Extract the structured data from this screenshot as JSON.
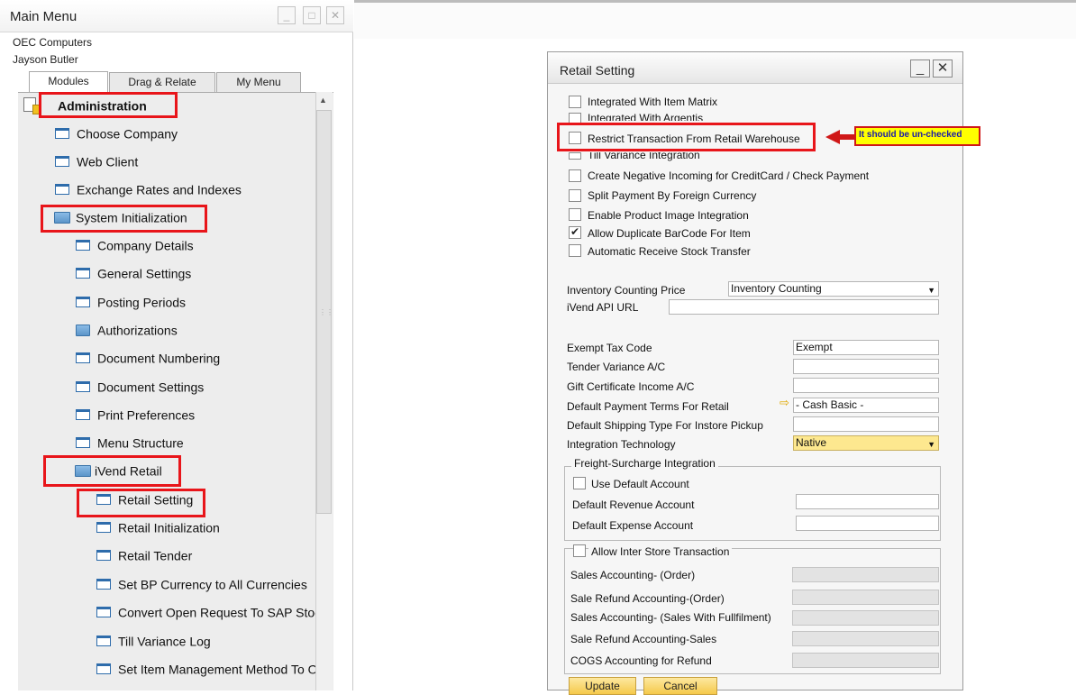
{
  "main_menu": {
    "title": "Main Menu",
    "company": "OEC Computers",
    "user": "Jayson Butler",
    "tabs": [
      "Modules",
      "Drag & Relate",
      "My Menu"
    ],
    "items": [
      {
        "label": "Administration"
      },
      {
        "label": "Choose Company"
      },
      {
        "label": "Web Client"
      },
      {
        "label": "Exchange Rates and Indexes"
      },
      {
        "label": "System Initialization"
      },
      {
        "label": "Company Details"
      },
      {
        "label": "General Settings"
      },
      {
        "label": "Posting Periods"
      },
      {
        "label": "Authorizations"
      },
      {
        "label": "Document Numbering"
      },
      {
        "label": "Document Settings"
      },
      {
        "label": "Print Preferences"
      },
      {
        "label": "Menu Structure"
      },
      {
        "label": "iVend Retail"
      },
      {
        "label": "Retail Setting"
      },
      {
        "label": "Retail Initialization"
      },
      {
        "label": "Retail Tender"
      },
      {
        "label": "Set BP Currency to All Currencies"
      },
      {
        "label": "Convert Open Request To SAP Stock Transfer"
      },
      {
        "label": "Till Variance Log"
      },
      {
        "label": "Set Item Management Method To On Every Transaction"
      }
    ]
  },
  "dialog": {
    "title": "Retail Setting",
    "checkboxes": [
      {
        "label": "Integrated With Item Matrix",
        "checked": false
      },
      {
        "label": "Integrated With Argentis",
        "checked": false
      },
      {
        "label": "Restrict Transaction From Retail Warehouse",
        "checked": false
      },
      {
        "label": "Till Variance Integration",
        "checked": false
      },
      {
        "label": "Create Negative Incoming for CreditCard / Check Payment",
        "checked": false
      },
      {
        "label": "Split Payment By Foreign Currency",
        "checked": false
      },
      {
        "label": "Enable Product Image Integration",
        "checked": false
      },
      {
        "label": "Allow Duplicate BarCode For Item",
        "checked": true
      },
      {
        "label": "Automatic Receive Stock Transfer",
        "checked": false
      }
    ],
    "inventory_counting_price": {
      "label": "Inventory Counting Price",
      "value": "Inventory Counting"
    },
    "ivend_api_url": {
      "label": "iVend API URL",
      "value": ""
    },
    "fields": [
      {
        "label": "Exempt Tax Code",
        "value": "Exempt"
      },
      {
        "label": "Tender Variance A/C",
        "value": ""
      },
      {
        "label": "Gift Certificate Income A/C",
        "value": ""
      },
      {
        "label": "Default Payment Terms For Retail",
        "value": "- Cash Basic -"
      },
      {
        "label": "Default Shipping Type For Instore Pickup",
        "value": ""
      },
      {
        "label": "Integration Technology",
        "value": "Native"
      }
    ],
    "freight_group": {
      "title": "Freight-Surcharge Integration",
      "use_default": "Use Default Account",
      "revenue": "Default Revenue Account",
      "expense": "Default Expense Account"
    },
    "inter_store": {
      "label": "Allow Inter Store Transaction",
      "fields": [
        "Sales Accounting- (Order)",
        "Sale Refund Accounting-(Order)",
        "Sales Accounting- (Sales With Fullfilment)",
        "Sale Refund Accounting-Sales",
        "COGS Accounting for Refund"
      ]
    },
    "buttons": {
      "update": "Update",
      "cancel": "Cancel"
    }
  },
  "callout": "It should be un-checked",
  "colors": {
    "highlight": "#e8151a",
    "callout_bg": "#ffff00",
    "button": "#f5c94a"
  }
}
